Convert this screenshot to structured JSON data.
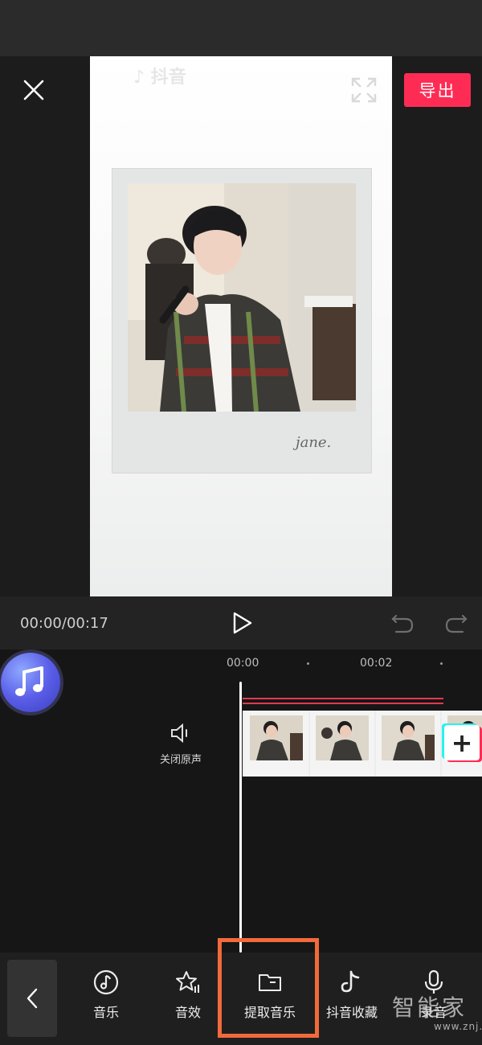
{
  "header": {
    "export_label": "导出"
  },
  "preview": {
    "app_watermark": "♪ 抖音",
    "photo_signature": "jane."
  },
  "playback": {
    "time_display": "00:00/00:17"
  },
  "timeline": {
    "ruler": [
      "00:00",
      "00:02"
    ],
    "mute_label": "关闭原声"
  },
  "toolbar": {
    "items": [
      {
        "label": "音乐",
        "icon": "music-note-icon"
      },
      {
        "label": "音效",
        "icon": "sound-effect-star-icon"
      },
      {
        "label": "提取音乐",
        "icon": "folder-icon"
      },
      {
        "label": "抖音收藏",
        "icon": "tiktok-icon"
      },
      {
        "label": "录音",
        "icon": "microphone-icon"
      }
    ],
    "highlighted_index": 2
  },
  "site_watermark": {
    "title": "智能家",
    "url": "www.znj.com"
  },
  "colors": {
    "accent": "#fe2c55",
    "highlight_box": "#f26a3b",
    "tiktok_cyan": "#25f4ee"
  }
}
